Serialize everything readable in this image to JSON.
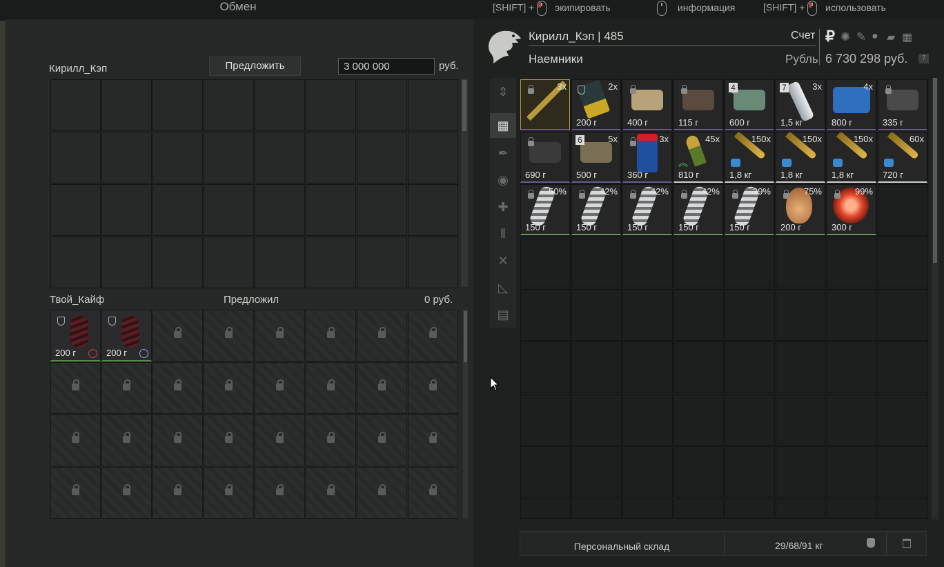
{
  "title": "Обмен",
  "hints": [
    {
      "prefix": "[SHIFT] +",
      "label": "экипировать",
      "mouse": "left"
    },
    {
      "prefix": "",
      "label": "информация",
      "mouse": "none"
    },
    {
      "prefix": "[SHIFT] +",
      "label": "использовать",
      "mouse": "right"
    }
  ],
  "trade": {
    "partner_name": "Кирилл_Кэп",
    "offer_button": "Предложить",
    "money_value": "3 000 000",
    "money_unit": "руб.",
    "my_name": "Твой_Кайф",
    "offered_label": "Предложил",
    "offered_amount": "0 руб.",
    "my_items": [
      {
        "weight": "200 г",
        "icon": "alarm-clock-icon"
      },
      {
        "weight": "200 г",
        "icon": "clock-icon"
      }
    ]
  },
  "profile": {
    "name_level": "Кирилл_Кэп | 485",
    "faction": "Наемники",
    "account_label": "Счет",
    "currency_label": "Рубль",
    "balance": "6 730 298 руб.",
    "help": "?"
  },
  "inventory": [
    {
      "count": "3x",
      "weight": "",
      "icon": "rifle-icon",
      "lock": true,
      "color": "#b89a3c"
    },
    {
      "count": "2x",
      "weight": "200 г",
      "icon": "keycard-icon",
      "shield": true,
      "color": "#c9a924"
    },
    {
      "count": "",
      "weight": "400 г",
      "icon": "suppressor-icon",
      "lock": true,
      "color": "#b8a27a"
    },
    {
      "count": "",
      "weight": "115 г",
      "icon": "scope-mount-icon",
      "lock": true,
      "color": "#5a4a40"
    },
    {
      "count": "",
      "weight": "600 г",
      "icon": "device-icon",
      "lock": true,
      "badge": "4",
      "color": "#6a8a78"
    },
    {
      "count": "3x",
      "weight": "1,5 кг",
      "icon": "bottle-icon",
      "badge": "7",
      "color": "#c8cdd2"
    },
    {
      "count": "4x",
      "weight": "800 г",
      "icon": "medkit-icon",
      "color": "#2f6fbf"
    },
    {
      "count": "",
      "weight": "335 г",
      "icon": "sight-icon",
      "lock": true,
      "color": "#4a4a4a"
    },
    {
      "count": "",
      "weight": "690 г",
      "icon": "scope-icon",
      "lock": true,
      "color": "#3a3a3a"
    },
    {
      "count": "5x",
      "weight": "500 г",
      "icon": "bandage-icon",
      "badge": "6",
      "color": "#7a6e55"
    },
    {
      "count": "3x",
      "weight": "360 г",
      "icon": "jar-icon",
      "lock": true,
      "color": "#1f4f9f"
    },
    {
      "count": "45x",
      "weight": "810 г",
      "icon": "grenade-round-icon",
      "color": "#5a8a3a"
    },
    {
      "count": "150x",
      "weight": "1,8 кг",
      "icon": "bullet-icon",
      "color": "#b8902c"
    },
    {
      "count": "150x",
      "weight": "1,8 кг",
      "icon": "bullet-icon",
      "color": "#b8902c"
    },
    {
      "count": "150x",
      "weight": "1,8 кг",
      "icon": "bullet-icon",
      "color": "#b8902c"
    },
    {
      "count": "60x",
      "weight": "720 г",
      "icon": "bullet-icon",
      "color": "#b8902c"
    },
    {
      "count": "50%",
      "weight": "150 г",
      "icon": "spiral-icon",
      "lock": true,
      "color": "#b9bcbd"
    },
    {
      "count": "42%",
      "weight": "150 г",
      "icon": "spiral-icon",
      "lock": true,
      "color": "#b9bcbd"
    },
    {
      "count": "42%",
      "weight": "150 г",
      "icon": "spiral-icon",
      "lock": true,
      "color": "#b9bcbd"
    },
    {
      "count": "42%",
      "weight": "150 г",
      "icon": "spiral-icon",
      "lock": true,
      "color": "#b9bcbd"
    },
    {
      "count": "39%",
      "weight": "150 г",
      "icon": "spiral-icon",
      "lock": true,
      "color": "#b9bcbd"
    },
    {
      "count": "75%",
      "weight": "200 г",
      "icon": "onion-icon",
      "lock": true,
      "color": "#c98a4a"
    },
    {
      "count": "99%",
      "weight": "300 г",
      "icon": "fire-orb-icon",
      "lock": true,
      "color": "#e0442a"
    }
  ],
  "footer": {
    "storage_label": "Персональный склад",
    "capacity": "29/68/91 кг"
  }
}
